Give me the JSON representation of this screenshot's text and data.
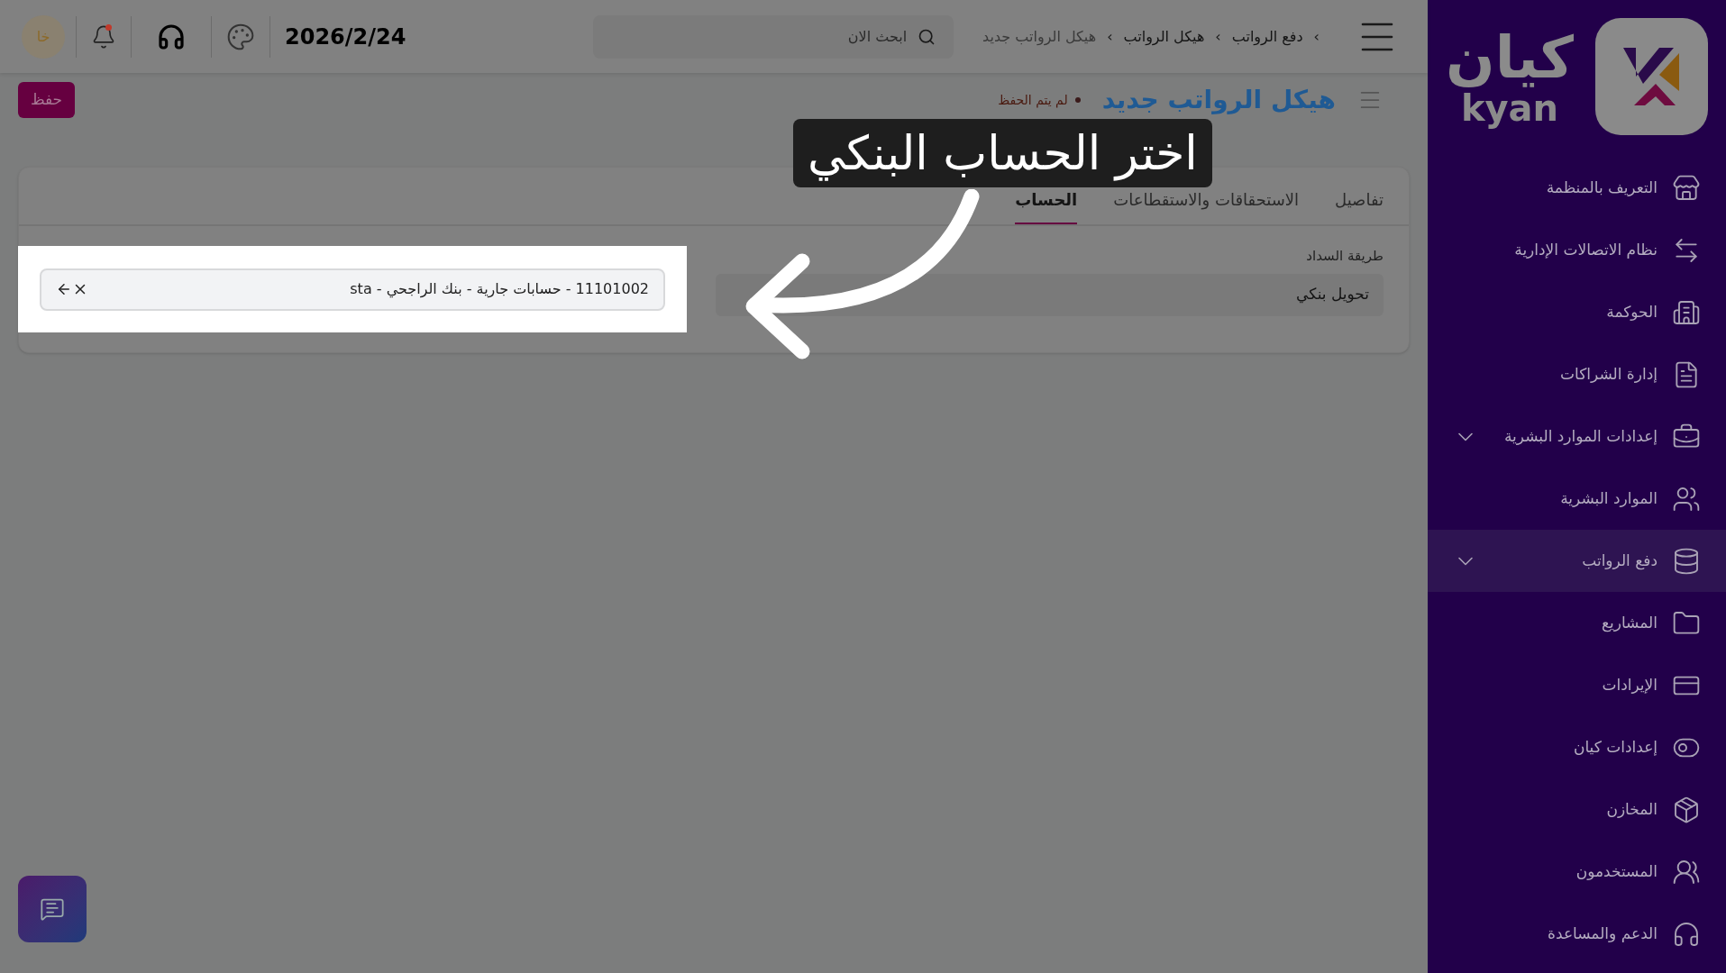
{
  "sidebar": {
    "logo": {
      "arabic": "كيان",
      "latin": "kyan"
    },
    "items": [
      {
        "label": "التعريف بالمنظمة",
        "expandable": false,
        "selected": false
      },
      {
        "label": "نظام الاتصالات الإدارية",
        "expandable": false,
        "selected": false
      },
      {
        "label": "الحوكمة",
        "expandable": false,
        "selected": false
      },
      {
        "label": "إدارة الشراكات",
        "expandable": false,
        "selected": false
      },
      {
        "label": "إعدادات الموارد البشرية",
        "expandable": true,
        "selected": false
      },
      {
        "label": "الموارد البشرية",
        "expandable": false,
        "selected": false
      },
      {
        "label": "دفع الرواتب",
        "expandable": true,
        "selected": true
      },
      {
        "label": "المشاريع",
        "expandable": false,
        "selected": false
      },
      {
        "label": "الإيرادات",
        "expandable": false,
        "selected": false
      },
      {
        "label": "إعدادات كيان",
        "expandable": false,
        "selected": false
      },
      {
        "label": "المخازن",
        "expandable": false,
        "selected": false
      },
      {
        "label": "المستخدمون",
        "expandable": false,
        "selected": false
      },
      {
        "label": "الدعم والمساعدة",
        "expandable": false,
        "selected": false
      }
    ]
  },
  "topbar": {
    "separator": "›",
    "breadcrumbs": [
      {
        "label": "دفع الرواتب",
        "current": false
      },
      {
        "label": "هيكل الرواتب",
        "current": false
      },
      {
        "label": "هيكل الرواتب جديد",
        "current": true
      }
    ],
    "search": {
      "placeholder": "ابحث الان"
    },
    "date": "2026/2/24",
    "notifications": true,
    "avatar": "خا"
  },
  "page": {
    "title": "هيكل الرواتب جديد",
    "status": "لم يتم الحفظ",
    "save_button": "حفظ",
    "tabs": [
      {
        "label": "تفاصيل",
        "selected": false
      },
      {
        "label": "الاستحقاقات والاستقطاعات",
        "selected": false
      },
      {
        "label": "الحساب",
        "selected": true
      }
    ],
    "payment_method": {
      "label": "طريقة السداد",
      "value": "تحويل بنكي"
    },
    "account": {
      "value": "11101002 - حسابات جارية - بنك الراجحي - sta"
    }
  },
  "tutorial": {
    "callout": "اختر الحساب البنكي"
  }
}
